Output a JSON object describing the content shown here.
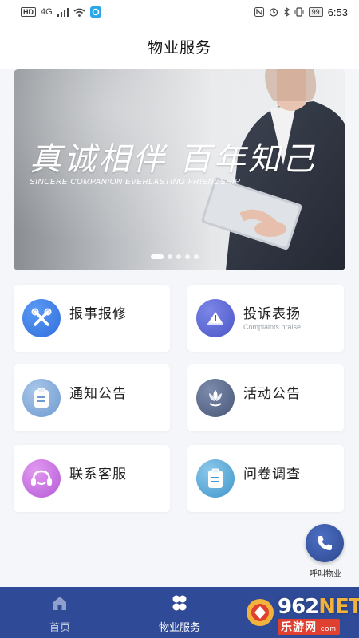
{
  "status_bar": {
    "hd": "HD",
    "network": "4G",
    "battery": "99",
    "time": "6:53"
  },
  "header": {
    "title": "物业服务"
  },
  "banner": {
    "slogan": "真诚相伴  百年知己",
    "subtitle": "SINCERE COMPANION  EVERLASTING FRIENDSHIP",
    "slides": 5,
    "active_slide": 1
  },
  "services": [
    {
      "label": "报事报修",
      "sub": "",
      "icon": "tools-icon",
      "color": "#3a7be8"
    },
    {
      "label": "投诉表扬",
      "sub": "Complaints praise",
      "icon": "megaphone-icon",
      "color": "#5a68d6"
    },
    {
      "label": "通知公告",
      "sub": "",
      "icon": "clipboard-icon",
      "color": "#7fa8d6"
    },
    {
      "label": "活动公告",
      "sub": "",
      "icon": "flower-icon",
      "color": "#5b6d93"
    },
    {
      "label": "联系客服",
      "sub": "",
      "icon": "headset-icon",
      "color": "#c26cdc"
    },
    {
      "label": "问卷调查",
      "sub": "",
      "icon": "clipboard-icon",
      "color": "#5aaad4"
    }
  ],
  "call_button": {
    "label": "呼叫物业",
    "icon": "phone-icon"
  },
  "bottom_nav": [
    {
      "label": "首页",
      "icon": "home-icon",
      "active": false
    },
    {
      "label": "物业服务",
      "icon": "clover-icon",
      "active": true
    }
  ],
  "watermark": {
    "number": "962",
    "net": "NET",
    "text": "乐游网",
    "domain": "com"
  },
  "colors": {
    "nav_bg": "#2f4b97",
    "fab": "#2c478e"
  }
}
